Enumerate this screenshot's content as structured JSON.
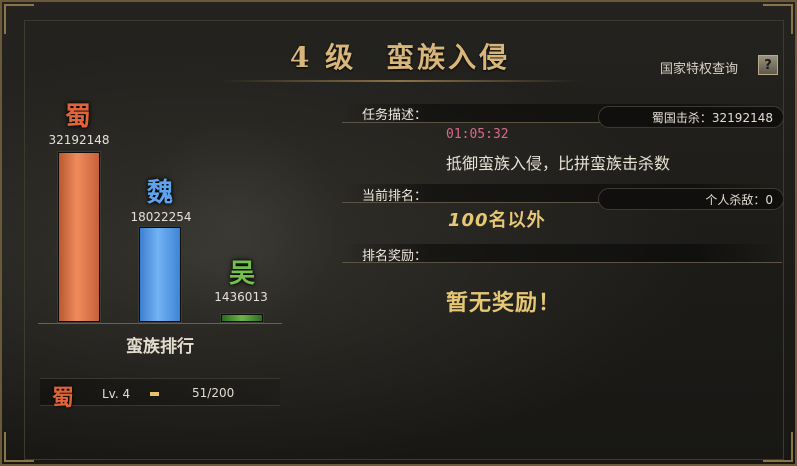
{
  "header": {
    "level": "4 级",
    "event": "蛮族入侵",
    "privilege_link": "国家特权查询",
    "help_label": "?"
  },
  "ranking": {
    "kingdoms": [
      {
        "name": "蜀",
        "kills": "32192148",
        "value": 32192148,
        "color": "#e0643a",
        "bar_color": "#e87b4a"
      },
      {
        "name": "魏",
        "kills": "18022254",
        "value": 18022254,
        "color": "#5fa3ee",
        "bar_color": "#5ea2ef"
      },
      {
        "name": "吴",
        "kills": "1436013",
        "value": 1436013,
        "color": "#74c04e",
        "bar_color": "#4e9a35"
      }
    ],
    "title": "蛮族排行"
  },
  "player": {
    "kingdom": "蜀",
    "level": "Lv. 4",
    "exp_text": "51/200",
    "exp_current": 51,
    "exp_max": 200
  },
  "task": {
    "label": "任务描述：",
    "kill_label": "蜀国击杀：32192148",
    "timer": "01:05:32",
    "description": "抵御蛮族入侵，比拼蛮族击杀数"
  },
  "rank": {
    "label": "当前排名：",
    "personal_kills": "个人杀敌：0",
    "rank_prefix": "100",
    "rank_suffix": "名以外"
  },
  "reward": {
    "label": "排名奖励：",
    "text": "暂无奖励！"
  },
  "colors": {
    "gold": "#e6c774",
    "title_gold": "#d8b679",
    "timer_pink": "#d76a8a"
  }
}
